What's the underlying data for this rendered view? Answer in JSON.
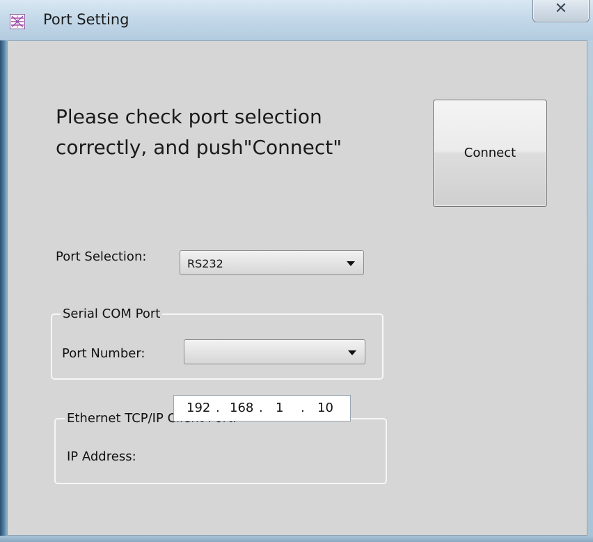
{
  "window": {
    "title": "Port Setting",
    "close_glyph": "✕"
  },
  "instruction": {
    "line1": "Please check port selection",
    "line2": "correctly, and push\"Connect\""
  },
  "connect_button": {
    "label": "Connect"
  },
  "port_selection": {
    "label": "Port Selection:",
    "selected": "RS232"
  },
  "serial_group": {
    "title": "Serial COM Port",
    "port_number_label": "Port Number:",
    "port_number_value": ""
  },
  "ethernet_group": {
    "title": "Ethernet TCP/IP Client Port:",
    "ip_label": "IP Address:",
    "ip": {
      "o1": "192",
      "o2": "168",
      "o3": "1",
      "o4": "10",
      "dot": "."
    }
  },
  "icons": {
    "app": "port-setting-app-icon",
    "close": "close-icon",
    "dropdown": "chevron-down-icon"
  }
}
